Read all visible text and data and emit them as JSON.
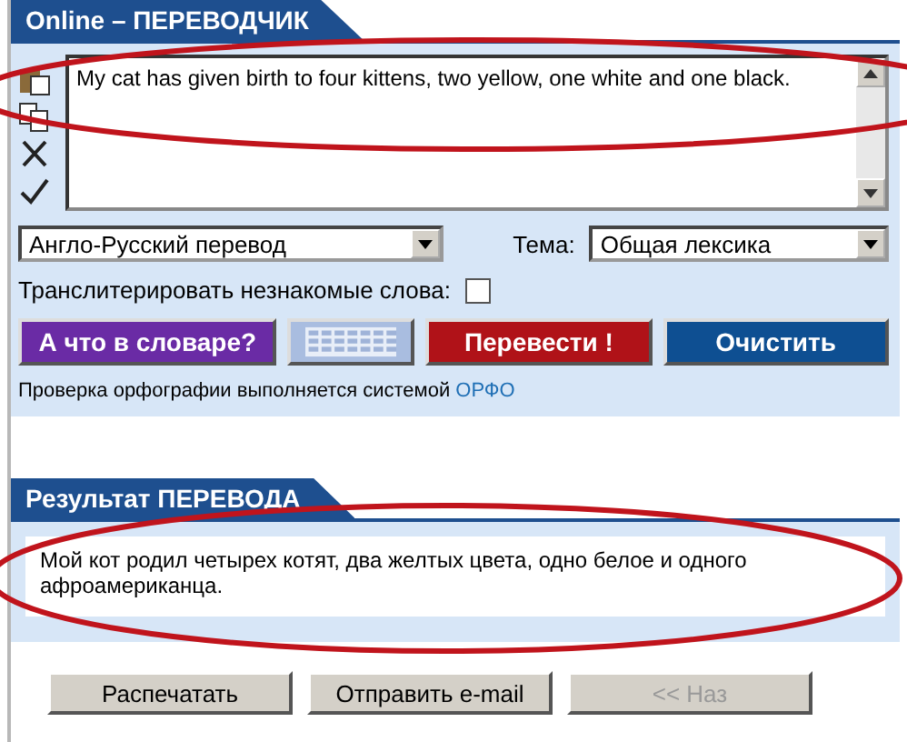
{
  "translator": {
    "title": "Online – ПЕРЕВОДЧИК",
    "tools": [
      {
        "kind": "paste"
      },
      {
        "kind": "copy"
      },
      {
        "kind": "clear"
      },
      {
        "kind": "spell"
      }
    ],
    "source_text": "My cat has given birth to four kittens, two yellow, one white and one black.",
    "direction": {
      "value": "Англо-Русский перевод"
    },
    "topic": {
      "label": "Тема:",
      "value": "Общая лексика"
    },
    "transliterate": {
      "label": "Транслитерировать незнакомые слова:",
      "checked": false
    },
    "buttons": [
      {
        "kind": "dictionary",
        "label": "А что в словаре?"
      },
      {
        "kind": "keyboard"
      },
      {
        "kind": "translate",
        "label": "Перевести !"
      },
      {
        "kind": "clear",
        "label": "Очистить"
      }
    ],
    "spell_note": {
      "text": "Проверка орфографии выполняется системой",
      "link": "ОРФО"
    }
  },
  "result": {
    "title": "Результат ПЕРЕВОДА",
    "text": "Мой кот родил четырех котят, два желтых цвета, одно белое и одного афроамериканца.",
    "buttons": [
      {
        "label": "Распечатать",
        "disabled": false
      },
      {
        "label": "Отправить e-mail",
        "disabled": false
      },
      {
        "label": "<< Наз",
        "disabled": true
      }
    ]
  },
  "annotations": [
    {
      "kind": "ellipse"
    },
    {
      "kind": "ellipse"
    }
  ]
}
